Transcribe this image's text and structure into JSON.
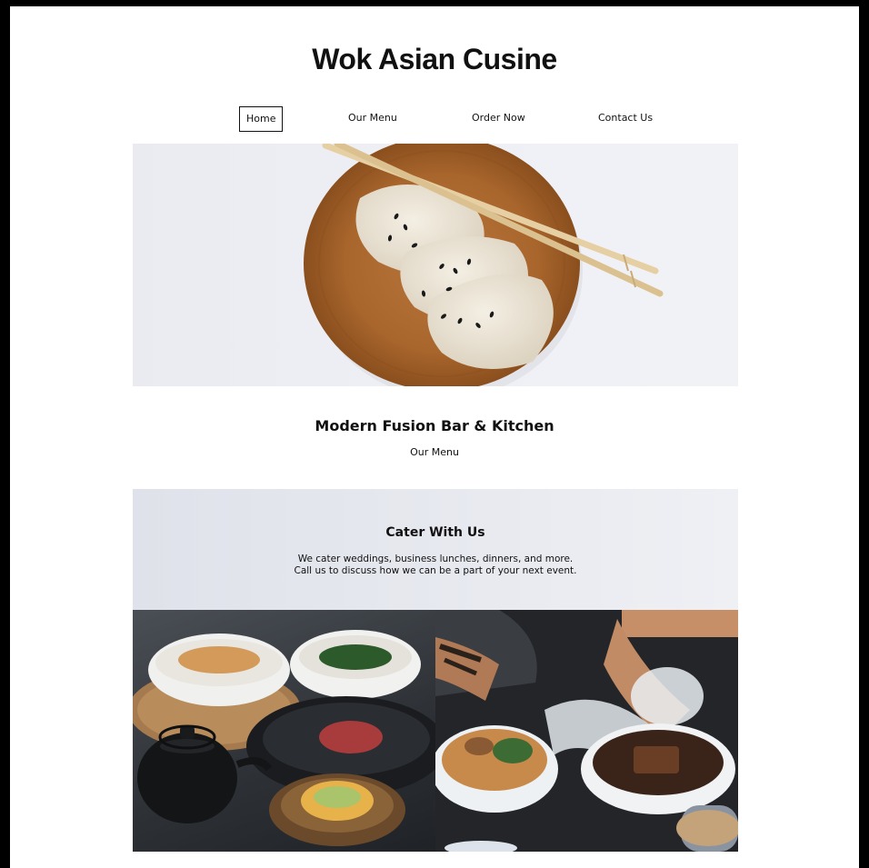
{
  "site": {
    "title": "Wok Asian Cusine"
  },
  "nav": {
    "items": [
      {
        "label": "Home",
        "active": true
      },
      {
        "label": "Our Menu",
        "active": false
      },
      {
        "label": "Order Now",
        "active": false
      },
      {
        "label": "Contact Us",
        "active": false
      }
    ]
  },
  "hero": {
    "image": "dumplings-on-wooden-plate-with-chopsticks"
  },
  "intro": {
    "heading": "Modern Fusion Bar & Kitchen",
    "link": "Our Menu"
  },
  "cater": {
    "heading": "Cater With Us",
    "line1": "We cater weddings, business lunches, dinners, and more.",
    "line2": "Call us to discuss how we can be a part of your next event."
  },
  "gallery": {
    "left_image": "japanese-dishes-with-teapot",
    "right_image": "chef-plating-ramen-bowls"
  },
  "colors": {
    "page_bg": "#ffffff",
    "frame": "#000000",
    "text": "#111111",
    "cater_bg": "#e5e7ee"
  }
}
